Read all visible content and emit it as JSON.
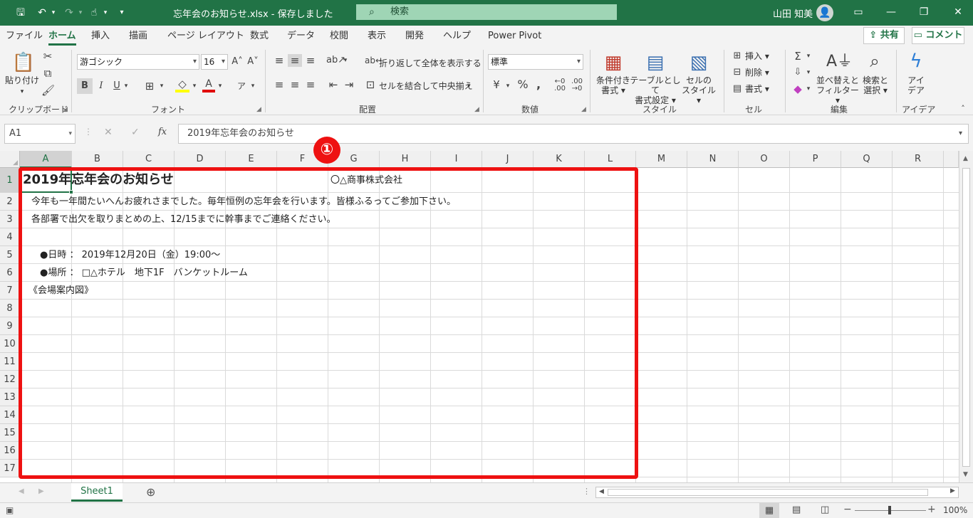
{
  "title_bar": {
    "doc_title": "忘年会のお知らせ.xlsx  -  保存しました",
    "search_placeholder": "検索",
    "user_name": "山田 知美"
  },
  "tabs": [
    "ファイル",
    "ホーム",
    "挿入",
    "描画",
    "ページ レイアウト",
    "数式",
    "データ",
    "校閲",
    "表示",
    "開発",
    "ヘルプ",
    "Power Pivot"
  ],
  "share_label": "共有",
  "comment_label": "コメント",
  "ribbon": {
    "clipboard": {
      "paste": "貼り付け",
      "label": "クリップボード"
    },
    "font": {
      "name": "游ゴシック",
      "size": "16",
      "label": "フォント"
    },
    "alignment": {
      "wrap": "折り返して全体を表示する",
      "merge": "セルを結合して中央揃え",
      "label": "配置"
    },
    "number": {
      "format": "標準",
      "label": "数値"
    },
    "styles": {
      "conditional": [
        "条件付き",
        "書式"
      ],
      "table": [
        "テーブルとして",
        "書式設定"
      ],
      "cell": [
        "セルの",
        "スタイル"
      ],
      "label": "スタイル"
    },
    "cells": {
      "insert": "挿入",
      "delete": "削除",
      "format": "書式",
      "label": "セル"
    },
    "editing": {
      "sort": [
        "並べ替えと",
        "フィルター"
      ],
      "find": [
        "検索と",
        "選択"
      ],
      "label": "編集"
    },
    "ideas": {
      "name": [
        "アイ",
        "デア"
      ],
      "label": "アイデア"
    }
  },
  "formula_bar": {
    "name_box": "A1",
    "fx": "fx",
    "content": "2019年忘年会のお知らせ"
  },
  "columns": [
    "A",
    "B",
    "C",
    "D",
    "E",
    "F",
    "G",
    "H",
    "I",
    "J",
    "K",
    "L",
    "M",
    "N",
    "O",
    "P",
    "Q",
    "R"
  ],
  "rows": [
    "1",
    "2",
    "3",
    "4",
    "5",
    "6",
    "7",
    "8",
    "9",
    "10",
    "11",
    "12",
    "13",
    "14",
    "15",
    "16",
    "17"
  ],
  "cells": {
    "a1": "2019年忘年会のお知らせ",
    "g1": "〇△商事株式会社",
    "a2": "今年も一年間たいへんお疲れさまでした。毎年恒例の忘年会を行います。皆様ふるってご参加下さい。",
    "a3": "各部署で出欠を取りまとめの上、12/15までに幹事までご連絡ください。",
    "a5": "●日時 ： 2019年12月20日（金）19:00～",
    "a6": "●場所 ： □△ホテル　地下1F　バンケットルーム",
    "a7": "《会場案内図》"
  },
  "annotation_marker": "①",
  "sheet_tab": "Sheet1",
  "zoom": "100%"
}
